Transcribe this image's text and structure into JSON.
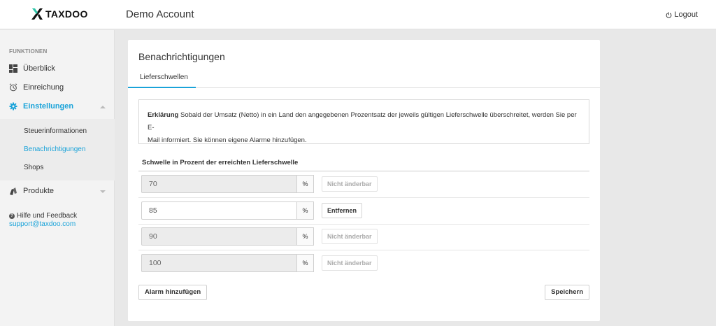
{
  "header": {
    "brand": "TAXDOO",
    "account": "Demo Account",
    "logout": "Logout"
  },
  "sidebar": {
    "heading": "FUNKTIONEN",
    "items": [
      {
        "label": "Überblick",
        "icon": "dashboard-icon"
      },
      {
        "label": "Einreichung",
        "icon": "alarm-clock-icon"
      },
      {
        "label": "Einstellungen",
        "icon": "gear-icon",
        "active": true
      },
      {
        "label": "Produkte",
        "icon": "products-icon"
      }
    ],
    "subitems": [
      {
        "label": "Steuerinformationen"
      },
      {
        "label": "Benachrichtigungen",
        "active": true
      },
      {
        "label": "Shops"
      }
    ],
    "help_label": "Hilfe und Feedback",
    "help_email": "support@taxdoo.com"
  },
  "main": {
    "title": "Benachrichtigungen",
    "tab": "Lieferschwellen",
    "info_bold": "Erklärung",
    "info_text1": " Sobald der Umsatz (Netto) in ein Land den angegebenen Prozentsatz der jeweils gültigen Lieferschwelle überschreitet, werden Sie per E-",
    "info_text2": "Mail informiert. Sie können eigene Alarme hinzufügen.",
    "section_label": "Schwelle in Prozent der erreichten Lieferschwelle",
    "thresholds": [
      {
        "value": "70",
        "unit": "%",
        "action": "Nicht änderbar",
        "editable": false
      },
      {
        "value": "85",
        "unit": "%",
        "action": "Entfernen",
        "editable": true
      },
      {
        "value": "90",
        "unit": "%",
        "action": "Nicht änderbar",
        "editable": false
      },
      {
        "value": "100",
        "unit": "%",
        "action": "Nicht änderbar",
        "editable": false
      }
    ],
    "add_button": "Alarm hinzufügen",
    "save_button": "Speichern"
  },
  "colors": {
    "accent": "#1aa3d9",
    "background": "#e8e8e8"
  }
}
